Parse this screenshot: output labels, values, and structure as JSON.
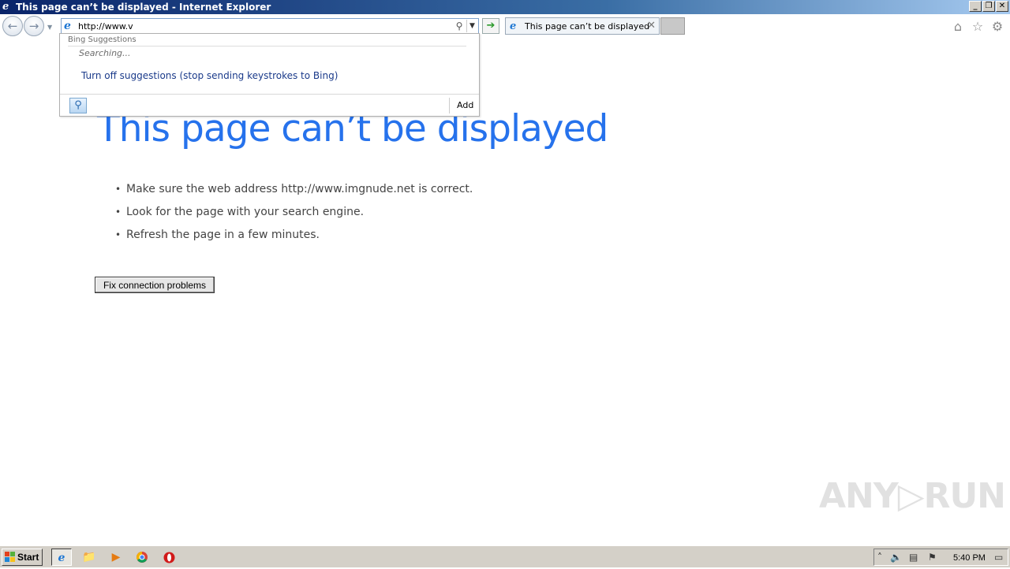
{
  "window": {
    "title": "This page can’t be displayed - Internet Explorer",
    "icon": "ie-logo-icon",
    "controls": {
      "minimize": "_",
      "restore": "❐",
      "close": "✕"
    }
  },
  "toolbar": {
    "back_icon": "back-arrow-icon",
    "forward_icon": "forward-arrow-icon",
    "address_value": "http://www.v",
    "tab_title": "This page can’t be displayed",
    "right_icons": [
      "home-icon",
      "favorites-star-icon",
      "gear-icon"
    ]
  },
  "suggestions": {
    "header": "Bing Suggestions",
    "status": "Searching...",
    "turn_off": "Turn off suggestions (stop sending keystrokes to Bing)",
    "add_label": "Add"
  },
  "content": {
    "heading": "This page can’t be displayed",
    "bullets": [
      "Make sure the web address http://www.imgnude.net is correct.",
      "Look for the page with your search engine.",
      "Refresh the page in a few minutes."
    ],
    "fix_button": "Fix connection problems"
  },
  "watermark": "ANY▷RUN",
  "taskbar": {
    "start_label": "Start",
    "apps": [
      "internet-explorer-icon",
      "folder-icon",
      "media-player-icon",
      "chrome-icon",
      "opera-icon"
    ],
    "clock": "5:40 PM",
    "colors": {
      "accent_heading": "#2672ec",
      "go_arrow": "#2b9a2b",
      "opera": "#d11a1a"
    }
  }
}
